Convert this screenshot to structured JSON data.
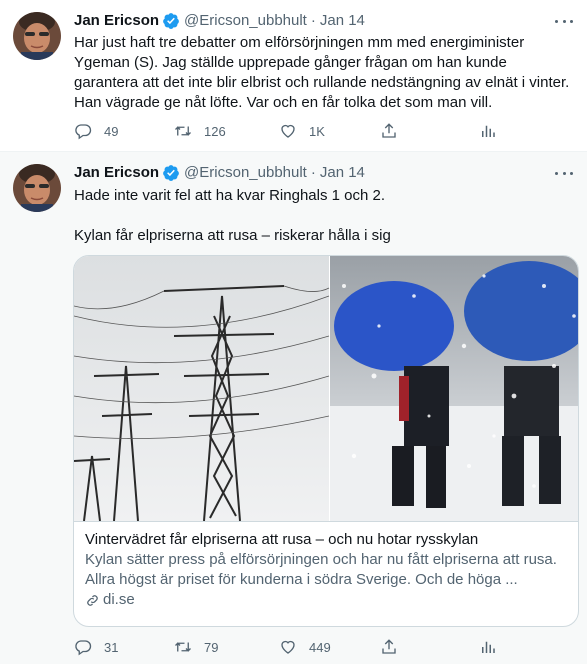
{
  "tweets": [
    {
      "author_name": "Jan Ericson",
      "handle": "@Ericson_ubbhult",
      "separator": "·",
      "date": "Jan 14",
      "text": "Har just haft tre debatter om elförsörjningen mm med energiminister Ygeman (S). Jag ställde upprepade gånger frågan om han kunde garantera att det inte blir elbrist och rullande nedstängning av elnät i vinter. Han vägrade ge nåt löfte. Var och en får tolka det som man vill.",
      "replies": "49",
      "retweets": "126",
      "likes": "1K"
    },
    {
      "author_name": "Jan Ericson",
      "handle": "@Ericson_ubbhult",
      "separator": "·",
      "date": "Jan 14",
      "text_line1": "Hade inte varit fel att ha kvar Ringhals 1 och 2.",
      "text_line2": "Kylan får elpriserna att rusa – riskerar hålla i sig",
      "replies": "31",
      "retweets": "79",
      "likes": "449",
      "card": {
        "title": "Vintervädret får elpriserna att rusa – och nu hotar rysskylan",
        "description": "Kylan sätter press på elförsörjningen och har nu fått elpriserna att rusa. Allra högst är priset för kunderna i södra Sverige. Och de höga ...",
        "domain": "di.se"
      }
    }
  ],
  "icons": {
    "verified": "verified-badge-icon",
    "reply": "reply-icon",
    "retweet": "retweet-icon",
    "like": "heart-icon",
    "share": "share-icon",
    "analytics": "analytics-icon",
    "more": "more-icon",
    "link": "link-icon"
  },
  "colors": {
    "text": "#0f1419",
    "secondary": "#536471",
    "verified": "#1d9bf0",
    "border": "#cfd9de",
    "hover_bg": "#f7f9f9"
  }
}
